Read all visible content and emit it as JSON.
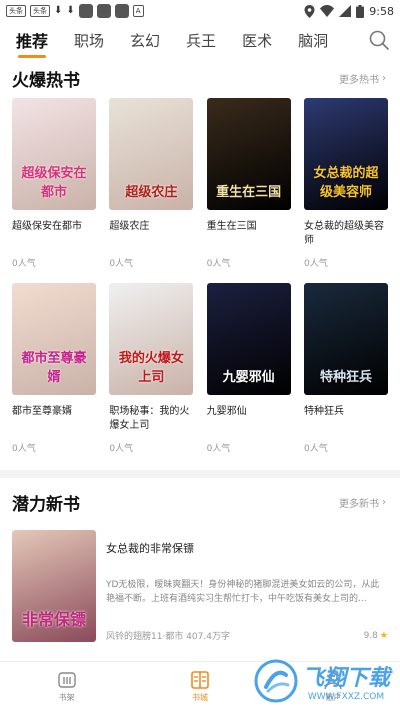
{
  "status_bar": {
    "chips": [
      "头条",
      "头条"
    ],
    "time": "9:58"
  },
  "nav": {
    "tabs": [
      {
        "label": "推荐",
        "active": true
      },
      {
        "label": "职场",
        "active": false
      },
      {
        "label": "玄幻",
        "active": false
      },
      {
        "label": "兵王",
        "active": false
      },
      {
        "label": "医术",
        "active": false
      },
      {
        "label": "脑洞",
        "active": false
      }
    ]
  },
  "hot_section": {
    "title": "火爆热书",
    "more": "更多热书",
    "books": [
      {
        "title": "超级保安在都市",
        "popularity": "0人气",
        "cover_text": "超级保安在都市",
        "cover_bg": "#f3e3e6",
        "accent": "#d8317a"
      },
      {
        "title": "超级农庄",
        "popularity": "0人气",
        "cover_text": "超级农庄",
        "cover_bg": "#e8e2d8",
        "accent": "#b0201a"
      },
      {
        "title": "重生在三国",
        "popularity": "0人气",
        "cover_text": "重生在三国",
        "cover_bg": "#3a2b1c",
        "accent": "#f2e0a8"
      },
      {
        "title": "女总裁的超级美容师",
        "popularity": "0人气",
        "cover_text": "女总裁的超级美容师",
        "cover_bg": "#2e3a73",
        "accent": "#f7c530"
      },
      {
        "title": "都市至尊豪婿",
        "popularity": "0人气",
        "cover_text": "都市至尊豪婿",
        "cover_bg": "#f2dcd0",
        "accent": "#c7208a"
      },
      {
        "title": "职场秘事：我的火爆女上司",
        "popularity": "0人气",
        "cover_text": "我的火爆女上司",
        "cover_bg": "#f0f0f0",
        "accent": "#c01818"
      },
      {
        "title": "九婴邪仙",
        "popularity": "0人气",
        "cover_text": "九婴邪仙",
        "cover_bg": "#1c2040",
        "accent": "#ffffff"
      },
      {
        "title": "特种狂兵",
        "popularity": "0人气",
        "cover_text": "特种狂兵",
        "cover_bg": "#1a2a3c",
        "accent": "#d8e4f0"
      }
    ]
  },
  "new_section": {
    "title": "潜力新书",
    "more": "更多新书",
    "feature": {
      "title": "女总裁的非常保镖",
      "desc": "YD无极限，暧昧爽翻天！身份神秘的猪脚混进美女如云的公司，从此艳福不断。上班有酒纯实习生帮忙打卡，中午吃饭有美女上司的...",
      "author_meta": "风铃的翅膀11·都市 407.4万字",
      "rating": "9.8",
      "cover_text": "非常保镖",
      "cover_bg": "#e4c8b8",
      "accent": "#c0287a"
    }
  },
  "bottom_nav": {
    "items": [
      {
        "label": "书架",
        "active": false
      },
      {
        "label": "书城",
        "active": true
      },
      {
        "label": "账户",
        "active": false
      }
    ]
  },
  "watermark": {
    "text": "飞翔下载",
    "sub": "WWW.FXXZ.COM"
  },
  "colors": {
    "accent": "#f08c1e",
    "muted": "#999999"
  }
}
